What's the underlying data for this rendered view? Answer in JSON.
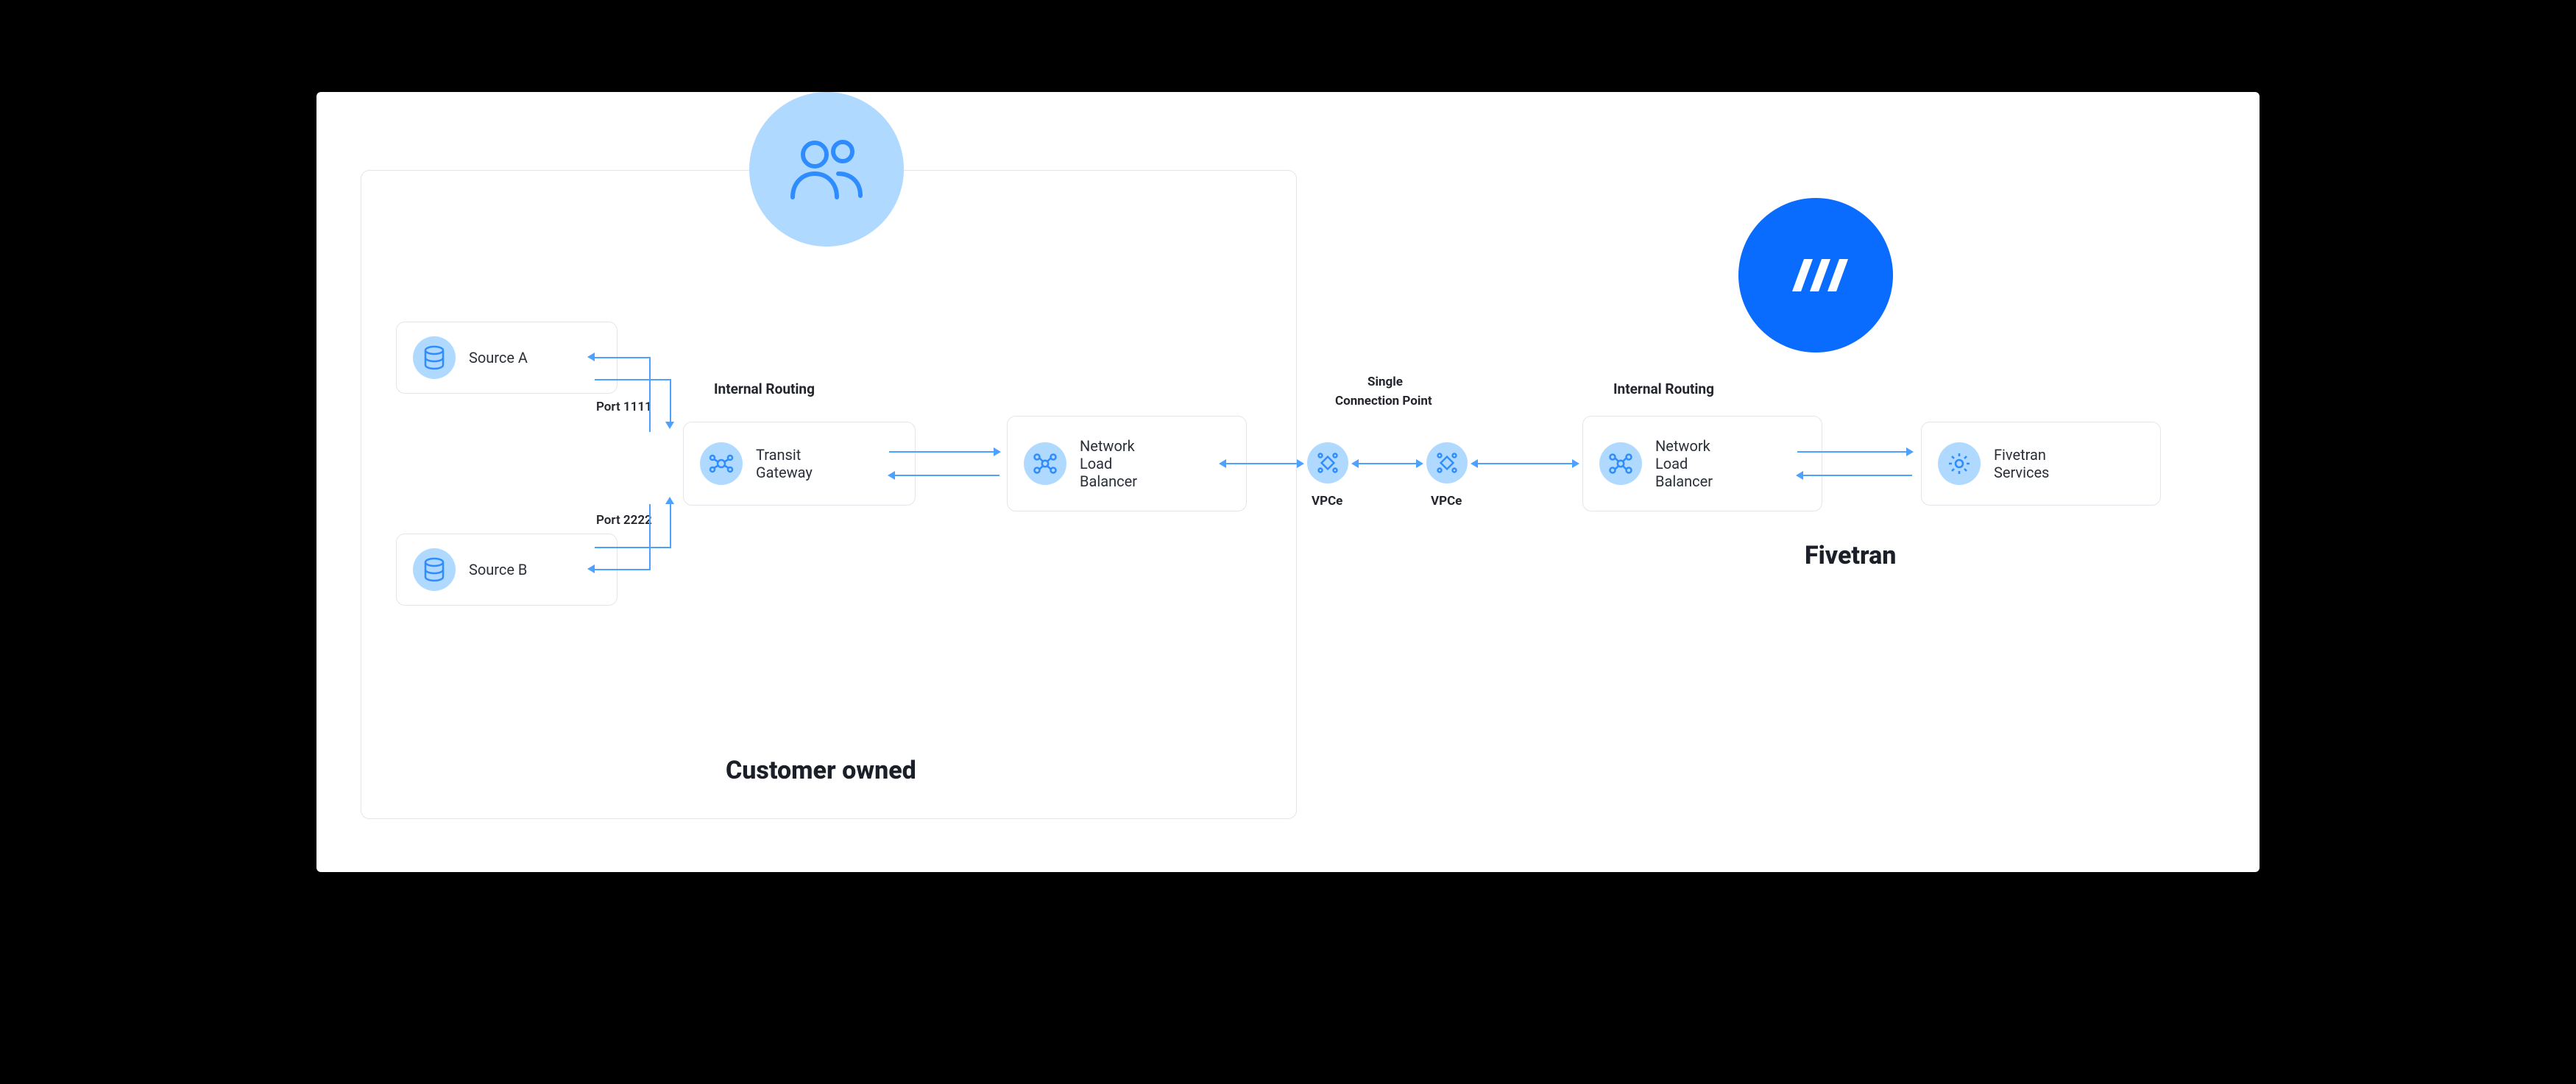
{
  "customer": {
    "title": "Customer owned",
    "internal_routing": "Internal Routing",
    "source_a": "Source A",
    "source_b": "Source B",
    "port_a": "Port 1111",
    "port_b": "Port 2222",
    "transit_gateway": "Transit\nGateway",
    "nlb": "Network\nLoad\nBalancer"
  },
  "middle": {
    "scp_line1": "Single",
    "scp_line2": "Connection Point",
    "vpce": "VPCe"
  },
  "fivetran": {
    "title": "Fivetran",
    "internal_routing": "Internal Routing",
    "nlb": "Network\nLoad\nBalancer",
    "services": "Fivetran\nServices"
  }
}
